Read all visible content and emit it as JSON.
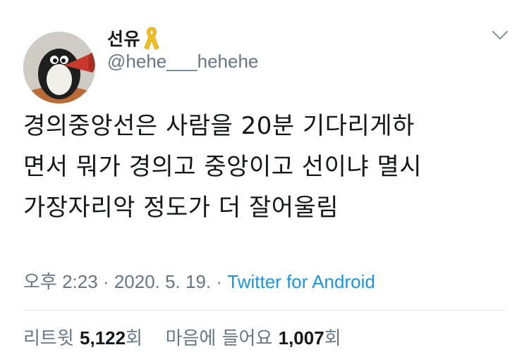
{
  "author": {
    "display_name": "선유",
    "handle": "@hehe___hehehe",
    "badge_icon": "yellow-ribbon-icon",
    "badge_color": "#f2c025"
  },
  "tweet": {
    "lines": [
      "경의중앙선은 사람을 20분 기다리게하",
      "면서 뭐가 경의고 중앙이고 선이냐 멸시",
      "가장자리악 정도가 더 잘어울림"
    ]
  },
  "meta": {
    "time": "오후 2:23",
    "separator": "·",
    "date": "2020. 5. 19.",
    "source": "Twitter for Android"
  },
  "stats": {
    "retweets_label": "리트윗",
    "retweets_count": "5,122",
    "retweets_unit": "회",
    "likes_label": "마음에 들어요",
    "likes_count": "1,007",
    "likes_unit": "회"
  },
  "colors": {
    "text": "#14171a",
    "secondary": "#657786",
    "link": "#1b95e0",
    "divider": "#e1e8ed"
  }
}
